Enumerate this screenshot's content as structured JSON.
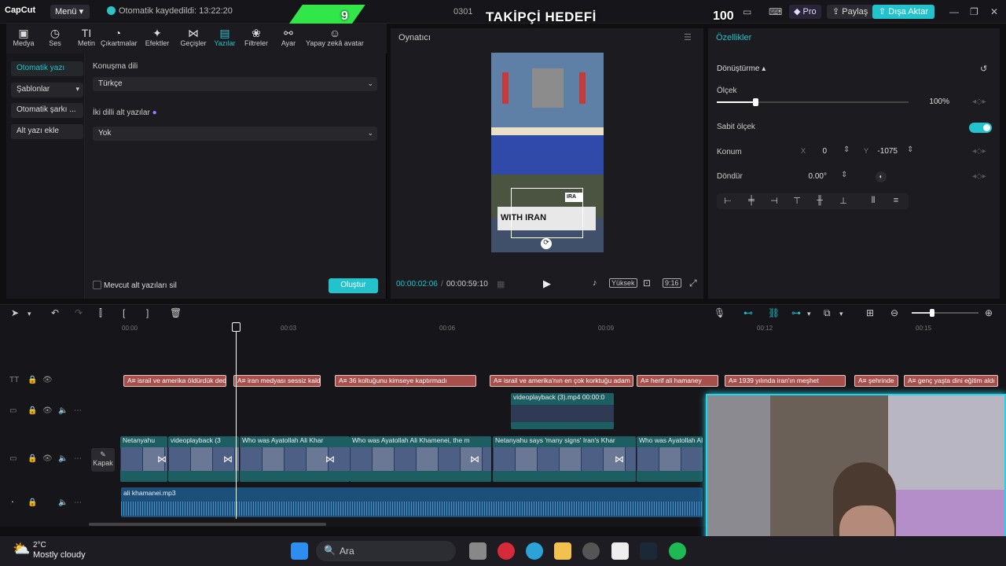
{
  "titlebar": {
    "app_name": "CapCut",
    "menu_label": "Menü",
    "autosave_text": "Otomatik kaydedildi: 13:22:20",
    "project_name": "0301",
    "pro_label": "Pro",
    "share_label": "Paylaş",
    "export_label": "Dışa Aktar"
  },
  "overlay": {
    "counter_left": "9",
    "title": "TAKİPÇİ HEDEFİ",
    "counter_right": "100"
  },
  "toolbar": {
    "items": [
      {
        "label": "Medya",
        "icon": "media-icon"
      },
      {
        "label": "Ses",
        "icon": "audio-icon"
      },
      {
        "label": "Metin",
        "icon": "text-icon"
      },
      {
        "label": "Çıkartmalar",
        "icon": "sticker-icon"
      },
      {
        "label": "Efektler",
        "icon": "effects-icon"
      },
      {
        "label": "Geçişler",
        "icon": "transitions-icon"
      },
      {
        "label": "Yazılar",
        "icon": "captions-icon"
      },
      {
        "label": "Filtreler",
        "icon": "filters-icon"
      },
      {
        "label": "Ayar",
        "icon": "adjust-icon"
      },
      {
        "label": "Yapay zekâ avatar",
        "icon": "ai-avatar-icon"
      }
    ],
    "active_index": 6
  },
  "leftnav": {
    "items": [
      "Otomatik yazı",
      "Şablonlar",
      "Otomatik şarkı ...",
      "Alt yazı ekle"
    ]
  },
  "captions": {
    "language_label": "Konuşma dili",
    "language_value": "Türkçe",
    "bilingual_label": "İki dilli alt yazılar",
    "bilingual_value": "Yok",
    "clear_existing_label": "Mevcut alt yazıları sil",
    "create_label": "Oluştur"
  },
  "player": {
    "title": "Oynatıcı",
    "current_time": "00:00:02:06",
    "total_time": "00:00:59:10",
    "quality_label": "Yüksek",
    "ratio_label": "9:16",
    "video_caption": "WITH IRAN",
    "video_tag": "IRA"
  },
  "properties": {
    "title": "Özellikler",
    "section": "Dönüştürme",
    "scale_label": "Ölçek",
    "scale_value": "100%",
    "scale_fraction": 0.2,
    "uniform_scale_label": "Sabit ölçek",
    "position_label": "Konum",
    "x_label": "X",
    "x_value": "0",
    "y_label": "Y",
    "y_value": "-1075",
    "rotate_label": "Döndür",
    "rotate_value": "0.00°"
  },
  "timeline": {
    "ruler_marks": [
      "00:00",
      "00:03",
      "00:06",
      "00:09",
      "00:12",
      "00:15"
    ],
    "cover_label": "Kapak",
    "text_clips": [
      "israil ve amerika öldürdük dedi",
      "iran medyası sessiz kaldı",
      "36 koltuğunu kimseye kaptırmadı",
      "israil ve amerika'nın en çok korktuğu adam",
      "herif ali hamaney",
      "1939 yılında iran'ın meşhet",
      "şehrinde",
      "genç yaşta dini eğitim aldı"
    ],
    "overlay_clip": "videoplayback (3).mp4   00:00:0",
    "video_clips": [
      "Netanyahu",
      "videoplayback (3",
      "Who was Ayatollah Ali Khar",
      "Who was Ayatollah Ali Khamenei, the m",
      "Netanyahu says 'many signs' Iran's Khar",
      "Who was Ayatollah Al"
    ],
    "audio_clip": "ali khamanei.mp3"
  },
  "taskbar": {
    "weather_temp": "2°C",
    "weather_desc": "Mostly cloudy",
    "search_placeholder": "Ara"
  }
}
